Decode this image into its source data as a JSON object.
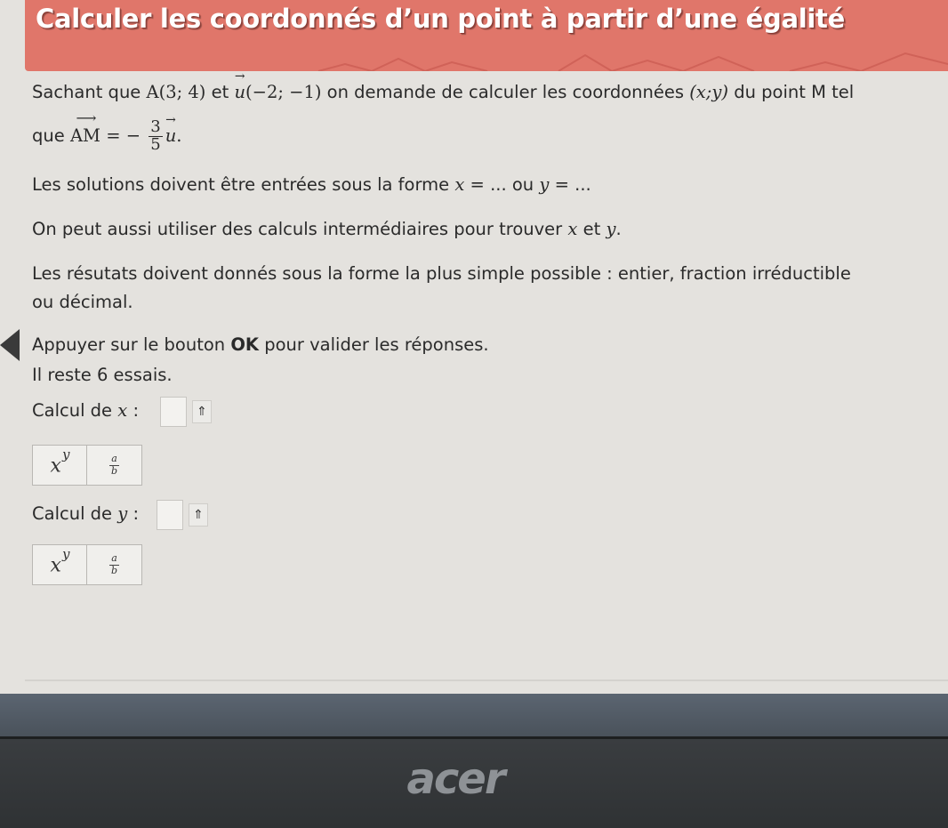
{
  "banner": {
    "title": "Calculer les coordonnés d’un point à partir d’une égalité",
    "color": "#e0766a"
  },
  "problem": {
    "p1_a": "Sachant que ",
    "p1_pointA": "A(3; 4)",
    "p1_b": " et ",
    "p1_vec_u": "u",
    "p1_u_coords": "(−2; −1)",
    "p1_c": " on demande de calculer les coordonnées ",
    "p1_xy": "(x;y)",
    "p1_d": " du point M tel",
    "p2_a": "que ",
    "p2_vec_am": "AM",
    "p2_eq": " = − ",
    "p2_frac_num": "3",
    "p2_frac_den": "5",
    "p2_vec_u": "u",
    "p2_end": ".",
    "p3_a": "Les solutions doivent être entrées sous la forme ",
    "p3_x": "x",
    "p3_b": " = ... ou ",
    "p3_y": "y",
    "p3_c": " = ...",
    "p4_a": "On peut aussi utiliser des calculs intermédiaires pour trouver ",
    "p4_x": "x",
    "p4_b": " et ",
    "p4_y": "y",
    "p4_c": ".",
    "p5": "Les résutats doivent donnés sous la forme la plus simple possible : entier, fraction irréductible",
    "p6": "ou décimal.",
    "p7_a": "Appuyer sur le bouton ",
    "p7_ok": "OK",
    "p7_b": " pour valider les réponses.",
    "p8": "Il reste 6 essais."
  },
  "calc_x": {
    "label": "Calcul de ",
    "var": "x",
    "colon": " :",
    "toggle": "⇑",
    "keys": {
      "pow_base": "x",
      "pow_exp": "y",
      "frac_num": "a",
      "frac_den": "b"
    }
  },
  "calc_y": {
    "label": "Calcul de ",
    "var": "y",
    "colon": " :",
    "toggle": "⇑",
    "keys": {
      "pow_base": "x",
      "pow_exp": "y",
      "frac_num": "a",
      "frac_den": "b"
    }
  },
  "device": {
    "brand": "acer"
  }
}
